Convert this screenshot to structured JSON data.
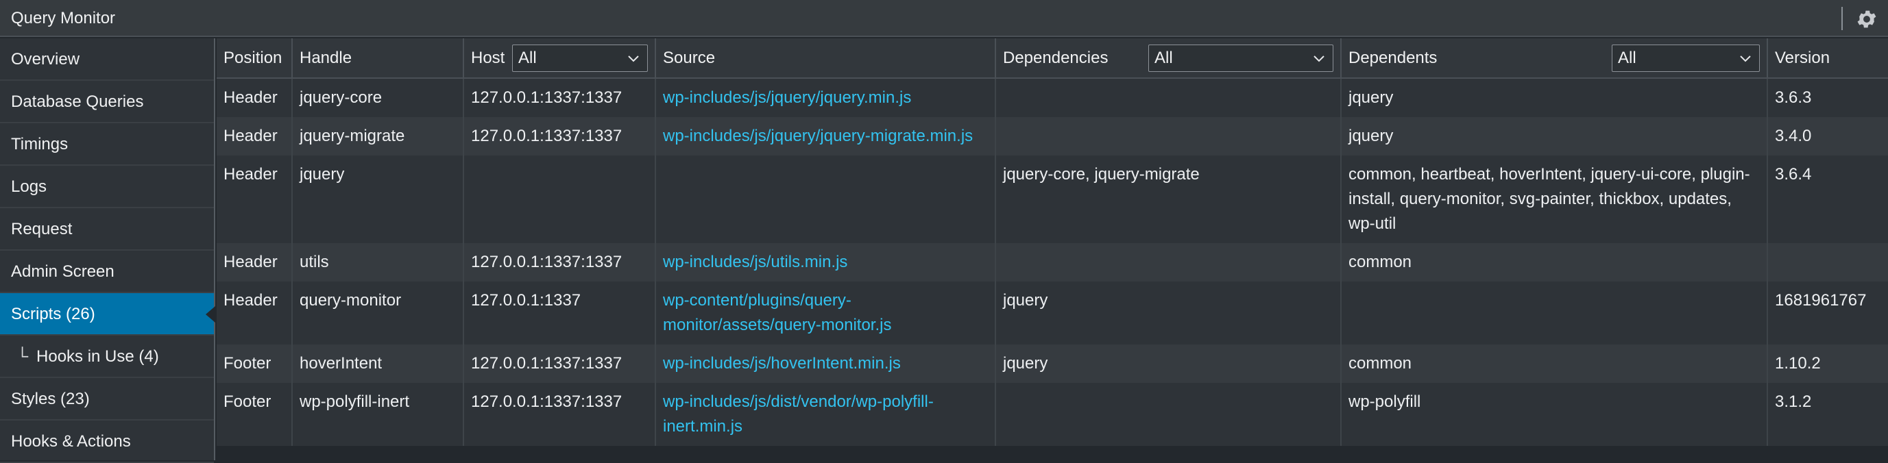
{
  "panel": {
    "title": "Query Monitor",
    "settings_icon": "gear-icon"
  },
  "sidebar": {
    "items": [
      {
        "label": "Overview"
      },
      {
        "label": "Database Queries"
      },
      {
        "label": "Timings"
      },
      {
        "label": "Logs"
      },
      {
        "label": "Request"
      },
      {
        "label": "Admin Screen"
      },
      {
        "label": "Scripts (26)",
        "active": true
      },
      {
        "label": "Hooks in Use (4)",
        "sub": true,
        "tree": "└"
      },
      {
        "label": "Styles (23)"
      },
      {
        "label": "Hooks & Actions"
      }
    ]
  },
  "table": {
    "headers": {
      "position": "Position",
      "handle": "Handle",
      "host": "Host",
      "host_filter": "All",
      "source": "Source",
      "dependencies": "Dependencies",
      "dependencies_filter": "All",
      "dependents": "Dependents",
      "dependents_filter": "All",
      "version": "Version"
    },
    "rows": [
      {
        "position": "Header",
        "handle": "jquery-core",
        "host": "127.0.0.1:1337:1337",
        "source": "wp-includes/js/jquery/jquery.min.js",
        "dependencies": "",
        "dependents": "jquery",
        "version": "3.6.3"
      },
      {
        "position": "Header",
        "handle": "jquery-migrate",
        "host": "127.0.0.1:1337:1337",
        "source": "wp-includes/js/jquery/jquery-migrate.min.js",
        "dependencies": "",
        "dependents": "jquery",
        "version": "3.4.0"
      },
      {
        "position": "Header",
        "handle": "jquery",
        "host": "",
        "source": "",
        "dependencies": "jquery-core, jquery-migrate",
        "dependents": "common, heartbeat, hoverIntent, jquery-ui-core, plugin-install, query-monitor, svg-painter, thickbox, updates, wp-util",
        "version": "3.6.4"
      },
      {
        "position": "Header",
        "handle": "utils",
        "host": "127.0.0.1:1337:1337",
        "source": "wp-includes/js/utils.min.js",
        "dependencies": "",
        "dependents": "common",
        "version": ""
      },
      {
        "position": "Header",
        "handle": "query-monitor",
        "host": "127.0.0.1:1337",
        "source": "wp-content/plugins/query-monitor/assets/query-monitor.js",
        "dependencies": "jquery",
        "dependents": "",
        "version": "1681961767"
      },
      {
        "position": "Footer",
        "handle": "hoverIntent",
        "host": "127.0.0.1:1337:1337",
        "source": "wp-includes/js/hoverIntent.min.js",
        "dependencies": "jquery",
        "dependents": "common",
        "version": "1.10.2"
      },
      {
        "position": "Footer",
        "handle": "wp-polyfill-inert",
        "host": "127.0.0.1:1337:1337",
        "source": "wp-includes/js/dist/vendor/wp-polyfill-inert.min.js",
        "dependencies": "",
        "dependents": "wp-polyfill",
        "version": "3.1.2"
      }
    ]
  }
}
